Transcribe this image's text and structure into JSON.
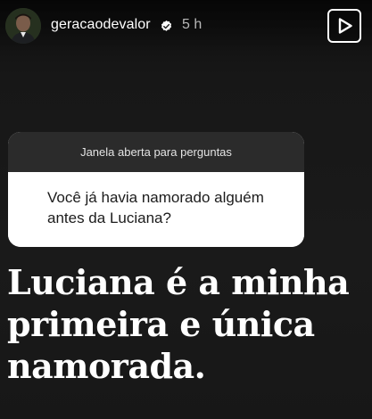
{
  "header": {
    "username": "geracaodevalor",
    "verified": true,
    "verified_icon": "verified-badge-icon",
    "time": "5 h",
    "play_icon": "play-icon"
  },
  "question_sticker": {
    "title": "Janela aberta para perguntas",
    "question": "Você já havia namorado alguém antes da Luciana?"
  },
  "answer_text": "Luciana é a minha primeira e única namorada.",
  "colors": {
    "background": "#1a1a1a",
    "sticker_header": "#2b2b2b",
    "sticker_body": "#ffffff",
    "text_primary": "#ffffff"
  }
}
